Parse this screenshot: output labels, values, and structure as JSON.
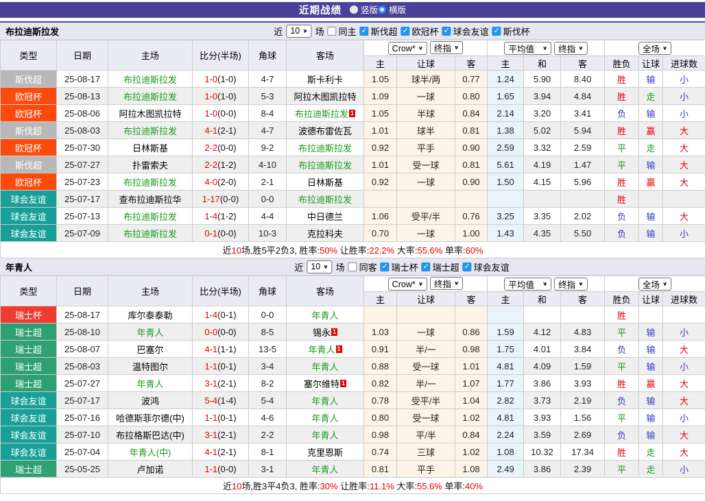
{
  "title_bar": {
    "title": "近期战绩",
    "radios": [
      {
        "label": "竖版",
        "selected": false
      },
      {
        "label": "横版",
        "selected": true
      }
    ]
  },
  "colors": {
    "accent_purple": "#4C4199",
    "badge": {
      "gray": "#B8B8B8",
      "orange": "#FB4A0C",
      "teal": "#18A098",
      "red": "#EF3B30",
      "green": "#2EA173"
    },
    "text": {
      "red": "#E60000",
      "green": "#1A9A1A",
      "blue": "#3737CC"
    }
  },
  "table_header": {
    "columns": [
      "类型",
      "日期",
      "主场",
      "比分(半场)",
      "角球",
      "客场"
    ],
    "selects": {
      "book": "Crow*",
      "book_final": "终指",
      "avg": "平均值",
      "avg_final": "终指",
      "scope": "全场"
    },
    "sub_columns": [
      "主",
      "让球",
      "客",
      "主",
      "和",
      "客",
      "胜负",
      "让球",
      "进球数"
    ]
  },
  "sections": [
    {
      "team": "布拉迪斯拉发",
      "filter": {
        "near": "近",
        "count": "10",
        "games": "场",
        "same": {
          "label": "同主",
          "checked": false
        },
        "leagues": [
          {
            "label": "斯伐超",
            "checked": true
          },
          {
            "label": "欧冠杯",
            "checked": true
          },
          {
            "label": "球会友谊",
            "checked": true
          },
          {
            "label": "斯伐杯",
            "checked": true
          }
        ]
      },
      "rows": [
        {
          "league": "斯伐超",
          "badge": "gray",
          "date": "25-08-17",
          "home": {
            "name": "布拉迪斯拉发",
            "focus": true
          },
          "score": "1-0",
          "half": "(1-0)",
          "corner": "4-7",
          "away": {
            "name": "斯卡利卡"
          },
          "crow": [
            "1.05",
            "球半/两",
            "0.77"
          ],
          "avg": [
            "1.24",
            "5.90",
            "8.40"
          ],
          "res": [
            [
              "胜",
              "r"
            ],
            [
              "输",
              "b"
            ],
            [
              "小",
              "b"
            ]
          ]
        },
        {
          "league": "欧冠杯",
          "badge": "orange",
          "date": "25-08-13",
          "home": {
            "name": "布拉迪斯拉发",
            "focus": true
          },
          "score": "1-0",
          "half": "(1-0)",
          "corner": "5-3",
          "away": {
            "name": "阿拉木图凯拉特"
          },
          "crow": [
            "1.09",
            "一球",
            "0.80"
          ],
          "avg": [
            "1.65",
            "3.94",
            "4.84"
          ],
          "res": [
            [
              "胜",
              "r"
            ],
            [
              "走",
              "g"
            ],
            [
              "小",
              "b"
            ]
          ]
        },
        {
          "league": "欧冠杯",
          "badge": "orange",
          "date": "25-08-06",
          "home": {
            "name": "阿拉木图凯拉特"
          },
          "score": "1-0",
          "half": "(0-0)",
          "corner": "8-4",
          "away": {
            "name": "布拉迪斯拉发",
            "focus": true,
            "card": "1"
          },
          "crow": [
            "1.05",
            "半球",
            "0.84"
          ],
          "avg": [
            "2.14",
            "3.20",
            "3.41"
          ],
          "res": [
            [
              "负",
              "b"
            ],
            [
              "输",
              "b"
            ],
            [
              "小",
              "b"
            ]
          ]
        },
        {
          "league": "斯伐超",
          "badge": "gray",
          "date": "25-08-03",
          "home": {
            "name": "布拉迪斯拉发",
            "focus": true
          },
          "score": "4-1",
          "half": "(2-1)",
          "corner": "4-7",
          "away": {
            "name": "波德布雷佐瓦"
          },
          "crow": [
            "1.01",
            "球半",
            "0.81"
          ],
          "avg": [
            "1.38",
            "5.02",
            "5.94"
          ],
          "res": [
            [
              "胜",
              "r"
            ],
            [
              "赢",
              "r"
            ],
            [
              "大",
              "r"
            ]
          ]
        },
        {
          "league": "欧冠杯",
          "badge": "orange",
          "date": "25-07-30",
          "home": {
            "name": "日林斯基"
          },
          "score": "2-2",
          "half": "(0-0)",
          "corner": "9-2",
          "away": {
            "name": "布拉迪斯拉发",
            "focus": true
          },
          "crow": [
            "0.92",
            "平手",
            "0.90"
          ],
          "avg": [
            "2.59",
            "3.32",
            "2.59"
          ],
          "res": [
            [
              "平",
              "g"
            ],
            [
              "走",
              "g"
            ],
            [
              "大",
              "r"
            ]
          ]
        },
        {
          "league": "斯伐超",
          "badge": "gray",
          "date": "25-07-27",
          "home": {
            "name": "扑雷索夫"
          },
          "score": "2-2",
          "half": "(1-2)",
          "corner": "4-10",
          "away": {
            "name": "布拉迪斯拉发",
            "focus": true
          },
          "crow": [
            "1.01",
            "受一球",
            "0.81"
          ],
          "avg": [
            "5.61",
            "4.19",
            "1.47"
          ],
          "res": [
            [
              "平",
              "g"
            ],
            [
              "输",
              "b"
            ],
            [
              "大",
              "r"
            ]
          ]
        },
        {
          "league": "欧冠杯",
          "badge": "orange",
          "date": "25-07-23",
          "home": {
            "name": "布拉迪斯拉发",
            "focus": true
          },
          "score": "4-0",
          "half": "(2-0)",
          "corner": "2-1",
          "away": {
            "name": "日林斯基"
          },
          "crow": [
            "0.92",
            "一球",
            "0.90"
          ],
          "avg": [
            "1.50",
            "4.15",
            "5.96"
          ],
          "res": [
            [
              "胜",
              "r"
            ],
            [
              "赢",
              "r"
            ],
            [
              "大",
              "r"
            ]
          ]
        },
        {
          "league": "球会友谊",
          "badge": "teal",
          "date": "25-07-17",
          "home": {
            "name": "查布拉迪斯拉华"
          },
          "score": "1-17",
          "half": "(0-0)",
          "corner": "0-0",
          "away": {
            "name": "布拉迪斯拉发",
            "focus": true
          },
          "crow": [
            "",
            "",
            ""
          ],
          "avg": [
            "",
            "",
            ""
          ],
          "res": [
            [
              "胜",
              "r"
            ],
            [
              "",
              ""
            ],
            [
              "",
              ""
            ]
          ]
        },
        {
          "league": "球会友谊",
          "badge": "teal",
          "date": "25-07-13",
          "home": {
            "name": "布拉迪斯拉发",
            "focus": true
          },
          "score": "1-4",
          "half": "(1-2)",
          "corner": "4-4",
          "away": {
            "name": "中日德兰"
          },
          "crow": [
            "1.06",
            "受平/半",
            "0.76"
          ],
          "avg": [
            "3.25",
            "3.35",
            "2.02"
          ],
          "res": [
            [
              "负",
              "b"
            ],
            [
              "输",
              "b"
            ],
            [
              "大",
              "r"
            ]
          ]
        },
        {
          "league": "球会友谊",
          "badge": "teal",
          "date": "25-07-09",
          "home": {
            "name": "布拉迪斯拉发",
            "focus": true
          },
          "score": "0-1",
          "half": "(0-0)",
          "corner": "10-3",
          "away": {
            "name": "克拉科夫"
          },
          "crow": [
            "0.70",
            "一球",
            "1.00"
          ],
          "avg": [
            "1.43",
            "4.35",
            "5.50"
          ],
          "res": [
            [
              "负",
              "b"
            ],
            [
              "输",
              "b"
            ],
            [
              "小",
              "b"
            ]
          ]
        }
      ],
      "summary": [
        {
          "t": "近",
          "c": "k"
        },
        {
          "t": "10",
          "c": "r"
        },
        {
          "t": "场,胜5平2负3, 胜率:",
          "c": "k"
        },
        {
          "t": "50%",
          "c": "r"
        },
        {
          "t": " 让胜率:",
          "c": "k"
        },
        {
          "t": "22.2%",
          "c": "r"
        },
        {
          "t": " 大率:",
          "c": "k"
        },
        {
          "t": "55.6%",
          "c": "r"
        },
        {
          "t": " 单率:",
          "c": "k"
        },
        {
          "t": "60%",
          "c": "r"
        }
      ]
    },
    {
      "team": "年青人",
      "filter": {
        "near": "近",
        "count": "10",
        "games": "场",
        "same": {
          "label": "同客",
          "checked": false
        },
        "leagues": [
          {
            "label": "瑞士杯",
            "checked": true
          },
          {
            "label": "瑞士超",
            "checked": true
          },
          {
            "label": "球会友谊",
            "checked": true
          }
        ]
      },
      "rows": [
        {
          "league": "瑞士杯",
          "badge": "red",
          "date": "25-08-17",
          "home": {
            "name": "库尔泰泰勒"
          },
          "score": "1-4",
          "half": "(0-1)",
          "corner": "0-0",
          "away": {
            "name": "年青人",
            "focus": true
          },
          "crow": [
            "",
            "",
            ""
          ],
          "avg": [
            "",
            "",
            ""
          ],
          "res": [
            [
              "胜",
              "r"
            ],
            [
              "",
              ""
            ],
            [
              "",
              ""
            ]
          ]
        },
        {
          "league": "瑞士超",
          "badge": "green",
          "date": "25-08-10",
          "home": {
            "name": "年青人",
            "focus": true
          },
          "score": "0-0",
          "half": "(0-0)",
          "corner": "8-5",
          "away": {
            "name": "锡永",
            "card": "1"
          },
          "crow": [
            "1.03",
            "一球",
            "0.86"
          ],
          "avg": [
            "1.59",
            "4.12",
            "4.83"
          ],
          "res": [
            [
              "平",
              "g"
            ],
            [
              "输",
              "b"
            ],
            [
              "小",
              "b"
            ]
          ]
        },
        {
          "league": "瑞士超",
          "badge": "green",
          "date": "25-08-07",
          "home": {
            "name": "巴塞尔"
          },
          "score": "4-1",
          "half": "(1-1)",
          "corner": "13-5",
          "away": {
            "name": "年青人",
            "focus": true,
            "card": "1"
          },
          "crow": [
            "0.91",
            "半/一",
            "0.98"
          ],
          "avg": [
            "1.75",
            "4.01",
            "3.84"
          ],
          "res": [
            [
              "负",
              "b"
            ],
            [
              "输",
              "b"
            ],
            [
              "大",
              "r"
            ]
          ]
        },
        {
          "league": "瑞士超",
          "badge": "green",
          "date": "25-08-03",
          "home": {
            "name": "温特图尔"
          },
          "score": "1-1",
          "half": "(0-1)",
          "corner": "3-4",
          "away": {
            "name": "年青人",
            "focus": true
          },
          "crow": [
            "0.88",
            "受一球",
            "1.01"
          ],
          "avg": [
            "4.81",
            "4.09",
            "1.59"
          ],
          "res": [
            [
              "平",
              "g"
            ],
            [
              "输",
              "b"
            ],
            [
              "小",
              "b"
            ]
          ]
        },
        {
          "league": "瑞士超",
          "badge": "green",
          "date": "25-07-27",
          "home": {
            "name": "年青人",
            "focus": true
          },
          "score": "3-1",
          "half": "(2-1)",
          "corner": "8-2",
          "away": {
            "name": "塞尔维特",
            "card": "1"
          },
          "crow": [
            "0.82",
            "半/一",
            "1.07"
          ],
          "avg": [
            "1.77",
            "3.86",
            "3.93"
          ],
          "res": [
            [
              "胜",
              "r"
            ],
            [
              "赢",
              "r"
            ],
            [
              "大",
              "r"
            ]
          ]
        },
        {
          "league": "球会友谊",
          "badge": "teal",
          "date": "25-07-17",
          "home": {
            "name": "波鸿"
          },
          "score": "5-4",
          "half": "(1-4)",
          "corner": "5-4",
          "away": {
            "name": "年青人",
            "focus": true
          },
          "crow": [
            "0.78",
            "受平/半",
            "1.04"
          ],
          "avg": [
            "2.82",
            "3.73",
            "2.19"
          ],
          "res": [
            [
              "负",
              "b"
            ],
            [
              "输",
              "b"
            ],
            [
              "大",
              "r"
            ]
          ]
        },
        {
          "league": "球会友谊",
          "badge": "teal",
          "date": "25-07-16",
          "home": {
            "name": "哈德斯菲尔德(中)"
          },
          "score": "1-1",
          "half": "(0-1)",
          "corner": "4-6",
          "away": {
            "name": "年青人",
            "focus": true
          },
          "crow": [
            "0.80",
            "受一球",
            "1.02"
          ],
          "avg": [
            "4.81",
            "3.93",
            "1.56"
          ],
          "res": [
            [
              "平",
              "g"
            ],
            [
              "输",
              "b"
            ],
            [
              "小",
              "b"
            ]
          ]
        },
        {
          "league": "球会友谊",
          "badge": "teal",
          "date": "25-07-10",
          "home": {
            "name": "布拉格斯巴达(中)"
          },
          "score": "3-1",
          "half": "(2-1)",
          "corner": "2-2",
          "away": {
            "name": "年青人",
            "focus": true
          },
          "crow": [
            "0.98",
            "平/半",
            "0.84"
          ],
          "avg": [
            "2.24",
            "3.59",
            "2.69"
          ],
          "res": [
            [
              "负",
              "b"
            ],
            [
              "输",
              "b"
            ],
            [
              "大",
              "r"
            ]
          ]
        },
        {
          "league": "球会友谊",
          "badge": "teal",
          "date": "25-07-04",
          "home": {
            "name": "年青人(中)",
            "focus": true
          },
          "score": "4-1",
          "half": "(2-1)",
          "corner": "8-1",
          "away": {
            "name": "克里恩斯"
          },
          "crow": [
            "0.74",
            "三球",
            "1.02"
          ],
          "avg": [
            "1.08",
            "10.32",
            "17.34"
          ],
          "res": [
            [
              "胜",
              "r"
            ],
            [
              "走",
              "g"
            ],
            [
              "大",
              "r"
            ]
          ]
        },
        {
          "league": "瑞士超",
          "badge": "green",
          "date": "25-05-25",
          "home": {
            "name": "卢加诺"
          },
          "score": "1-1",
          "half": "(0-0)",
          "corner": "3-1",
          "away": {
            "name": "年青人",
            "focus": true
          },
          "crow": [
            "0.81",
            "平手",
            "1.08"
          ],
          "avg": [
            "2.49",
            "3.86",
            "2.39"
          ],
          "res": [
            [
              "平",
              "g"
            ],
            [
              "走",
              "g"
            ],
            [
              "小",
              "b"
            ]
          ]
        }
      ],
      "summary": [
        {
          "t": "近",
          "c": "k"
        },
        {
          "t": "10",
          "c": "r"
        },
        {
          "t": "场,胜3平4负3, 胜率:",
          "c": "k"
        },
        {
          "t": "30%",
          "c": "r"
        },
        {
          "t": " 让胜率:",
          "c": "k"
        },
        {
          "t": "11.1%",
          "c": "r"
        },
        {
          "t": " 大率:",
          "c": "k"
        },
        {
          "t": "55.6%",
          "c": "r"
        },
        {
          "t": " 单率:",
          "c": "k"
        },
        {
          "t": "40%",
          "c": "r"
        }
      ]
    }
  ]
}
